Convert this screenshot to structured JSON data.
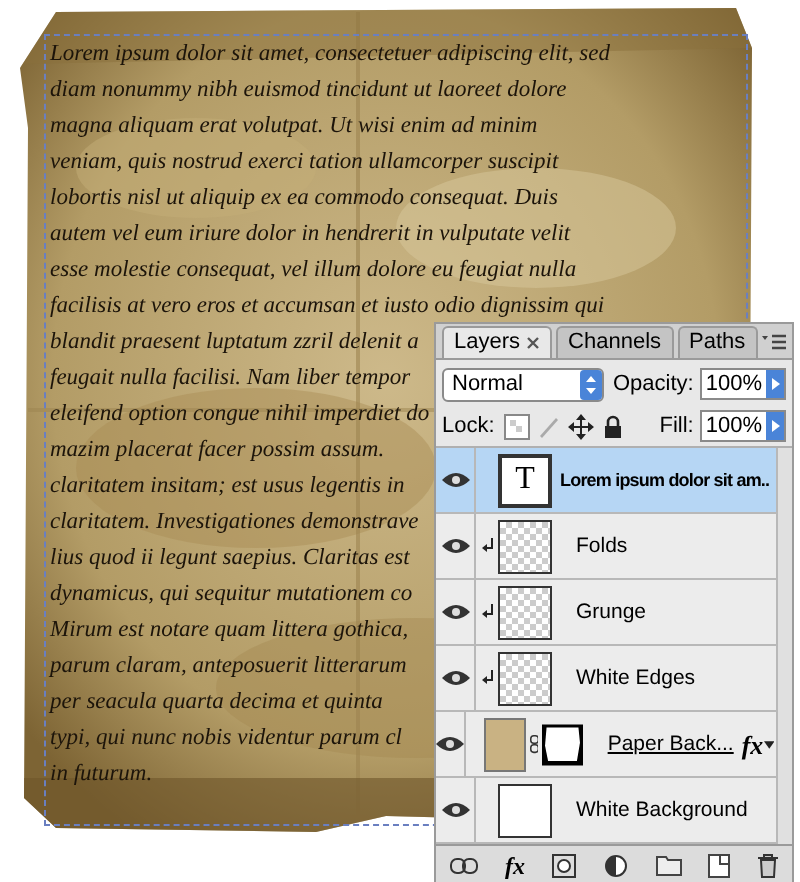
{
  "canvas": {
    "lines": [
      "Lorem ipsum dolor sit amet, consectetuer adipiscing elit, sed",
      "diam nonummy nibh euismod tincidunt ut laoreet dolore",
      "magna aliquam erat volutpat. Ut wisi enim ad minim",
      "veniam, quis nostrud exerci tation ullamcorper suscipit",
      "lobortis nisl ut aliquip ex ea commodo consequat. Duis",
      "autem vel eum iriure dolor in hendrerit in vulputate velit",
      "esse molestie consequat, vel illum dolore eu feugiat nulla",
      "facilisis at vero eros et accumsan et iusto odio dignissim qui",
      "blandit praesent luptatum zzril delenit a",
      "feugait nulla facilisi. Nam liber tempor",
      "eleifend option congue nihil imperdiet do",
      "mazim placerat facer possim assum.",
      "claritatem insitam; est usus legentis in",
      "claritatem. Investigationes demonstrave",
      "lius quod ii legunt saepius. Claritas est",
      "dynamicus, qui sequitur mutationem co",
      "Mirum est notare quam littera gothica,",
      "parum claram, anteposuerit litterarum",
      "per seacula quarta decima et quinta",
      "typi, qui nunc nobis videntur parum cl",
      "in futurum."
    ]
  },
  "layers_panel": {
    "tabs": [
      {
        "label": "Layers",
        "selected": true,
        "closable": true
      },
      {
        "label": "Channels",
        "selected": false,
        "closable": false
      },
      {
        "label": "Paths",
        "selected": false,
        "closable": false
      }
    ],
    "blend_mode": "Normal",
    "opacity_label": "Opacity:",
    "opacity": "100%",
    "lock_label": "Lock:",
    "fill_label": "Fill:",
    "fill": "100%",
    "layers": [
      {
        "name": "Lorem ipsum dolor sit am..",
        "kind": "text",
        "thumb_text": "T",
        "selected": true,
        "visible": true,
        "clipped": false
      },
      {
        "name": "Folds",
        "kind": "transparent",
        "selected": false,
        "visible": true,
        "clipped": true
      },
      {
        "name": "Grunge",
        "kind": "transparent",
        "selected": false,
        "visible": true,
        "clipped": true
      },
      {
        "name": "White Edges",
        "kind": "transparent",
        "selected": false,
        "visible": true,
        "clipped": true
      },
      {
        "name": "Paper Back...",
        "kind": "masked",
        "fx": "fx",
        "selected": false,
        "visible": true,
        "clipped": false
      },
      {
        "name": "White Background",
        "kind": "fill",
        "selected": false,
        "visible": true,
        "clipped": false
      }
    ],
    "toolbar_fx": "fx"
  }
}
